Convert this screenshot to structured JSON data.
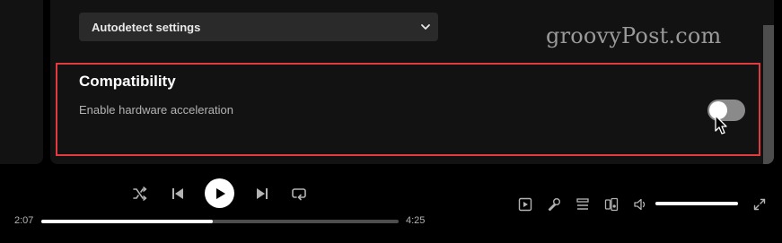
{
  "settings": {
    "select_value": "Autodetect settings",
    "section_title": "Compatibility",
    "hardware_acceleration_label": "Enable hardware acceleration",
    "hardware_acceleration_enabled": false
  },
  "watermark": "groovyPost.com",
  "player": {
    "elapsed": "2:07",
    "duration": "4:25",
    "progress_fraction": 0.48,
    "volume_fraction": 1.0
  },
  "colors": {
    "background": "#000000",
    "panel": "#121212",
    "highlight_frame": "#e33a3f",
    "toggle_off": "#8a8a8a"
  },
  "icons": {
    "shuffle": "shuffle-icon",
    "previous": "skip-previous-icon",
    "play": "play-icon",
    "next": "skip-next-icon",
    "repeat": "repeat-icon",
    "now_playing": "now-playing-view-icon",
    "lyrics": "microphone-icon",
    "queue": "queue-icon",
    "connect": "connect-device-icon",
    "volume": "volume-icon",
    "fullscreen": "fullscreen-icon"
  }
}
